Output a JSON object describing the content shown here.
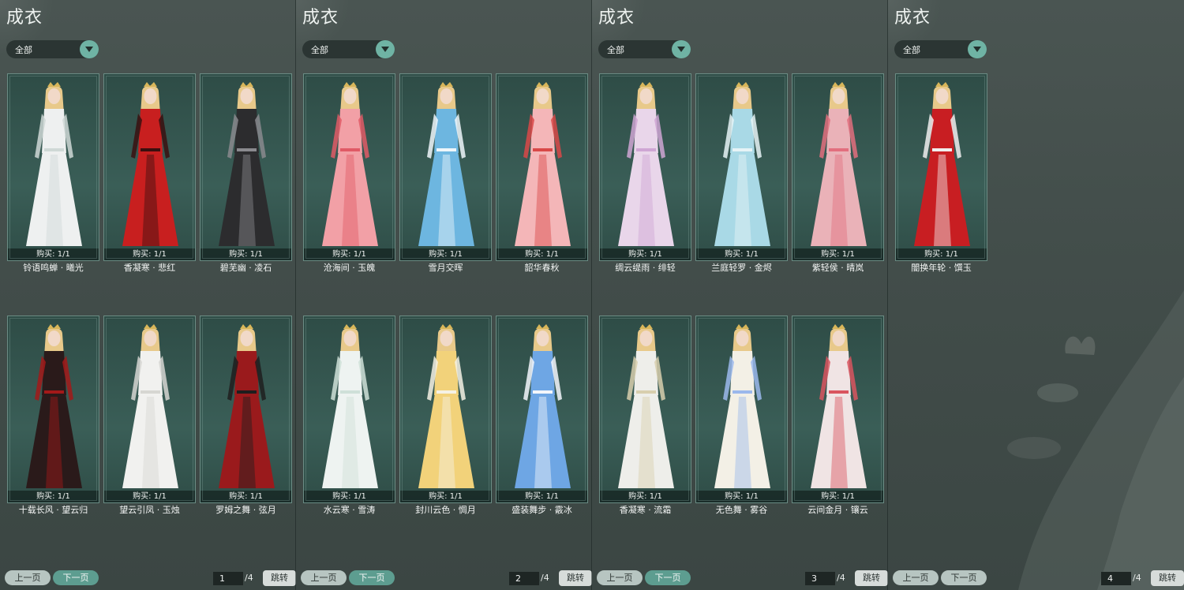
{
  "title": "成衣",
  "filter": {
    "label": "全部"
  },
  "pager": {
    "prev_label": "上一页",
    "next_label": "下一页",
    "jump_label": "跳转",
    "total": "/4"
  },
  "colors": {
    "card_bg": "#2e4c46",
    "accent": "#6fb3a4",
    "next_button": "#5d9d90"
  },
  "panels": [
    {
      "page": "1",
      "items": [
        {
          "name": "铃语鸣蝉 · 曦光",
          "buy": "购买: 1/1",
          "hair": "#e8c98a",
          "dress": "#eef0f0",
          "trim": "#cfd8d6"
        },
        {
          "name": "香凝寒 · 悲红",
          "buy": "购买: 1/1",
          "hair": "#e8c98a",
          "dress": "#c81f1f",
          "trim": "#3a1010"
        },
        {
          "name": "碧芜幽 · 凌石",
          "buy": "购买: 1/1",
          "hair": "#e8c98a",
          "dress": "#2c2c2e",
          "trim": "#8a8a8e"
        },
        {
          "name": "十载长风 · 望云归",
          "buy": "购买: 1/1",
          "hair": "#e8c98a",
          "dress": "#2a1a1a",
          "trim": "#a31919"
        },
        {
          "name": "望云引凤 · 玉烛",
          "buy": "购买: 1/1",
          "hair": "#e8c98a",
          "dress": "#f1f1ef",
          "trim": "#d6d6d2"
        },
        {
          "name": "罗姆之舞 · 弦月",
          "buy": "购买: 1/1",
          "hair": "#e8c98a",
          "dress": "#9a1a1c",
          "trim": "#1e1e1e"
        }
      ]
    },
    {
      "page": "2",
      "items": [
        {
          "name": "沧海间 · 玉魄",
          "buy": "购买: 1/1",
          "hair": "#e8c98a",
          "dress": "#f2a0a6",
          "trim": "#e05a66"
        },
        {
          "name": "雪月交晖",
          "buy": "购买: 1/1",
          "hair": "#e8c98a",
          "dress": "#6db6e0",
          "trim": "#eef6fa"
        },
        {
          "name": "韶华春秋",
          "buy": "购买: 1/1",
          "hair": "#e8c98a",
          "dress": "#f4b6b8",
          "trim": "#d94848"
        },
        {
          "name": "水云寒 · 雪涛",
          "buy": "购买: 1/1",
          "hair": "#e8c98a",
          "dress": "#eef3f1",
          "trim": "#cfe0d8"
        },
        {
          "name": "封川云色 · 惆月",
          "buy": "购买: 1/1",
          "hair": "#e8c98a",
          "dress": "#f2d27a",
          "trim": "#f5f1e4"
        },
        {
          "name": "盛装舞步 · 霰冰",
          "buy": "购买: 1/1",
          "hair": "#e8c98a",
          "dress": "#6ea6e4",
          "trim": "#f3f6fb"
        }
      ]
    },
    {
      "page": "3",
      "items": [
        {
          "name": "绸云缇雨 · 绯轻",
          "buy": "购买: 1/1",
          "hair": "#e8c98a",
          "dress": "#e9d6ea",
          "trim": "#cfa6d4"
        },
        {
          "name": "兰庭轻罗 · 金烬",
          "buy": "购买: 1/1",
          "hair": "#e8c98a",
          "dress": "#a9d9e6",
          "trim": "#e6f3f6"
        },
        {
          "name": "紫轻侯 · 晴岚",
          "buy": "购买: 1/1",
          "hair": "#e8c98a",
          "dress": "#eab2b8",
          "trim": "#e26f7e"
        },
        {
          "name": "香凝寒 · 流霜",
          "buy": "购买: 1/1",
          "hair": "#e8c98a",
          "dress": "#eeeeea",
          "trim": "#d8cfae"
        },
        {
          "name": "无色舞 · 雾谷",
          "buy": "购买: 1/1",
          "hair": "#e8c98a",
          "dress": "#f3f0e6",
          "trim": "#9bb8ec"
        },
        {
          "name": "云间金月 · 镶云",
          "buy": "购买: 1/1",
          "hair": "#e8c98a",
          "dress": "#f0e4e4",
          "trim": "#d9555f"
        }
      ]
    },
    {
      "page": "4",
      "items": [
        {
          "name": "闇换年轮 · 馔玉",
          "buy": "购买: 1/1",
          "hair": "#e8c98a",
          "dress": "#c81e22",
          "trim": "#f0eeee"
        }
      ]
    }
  ]
}
